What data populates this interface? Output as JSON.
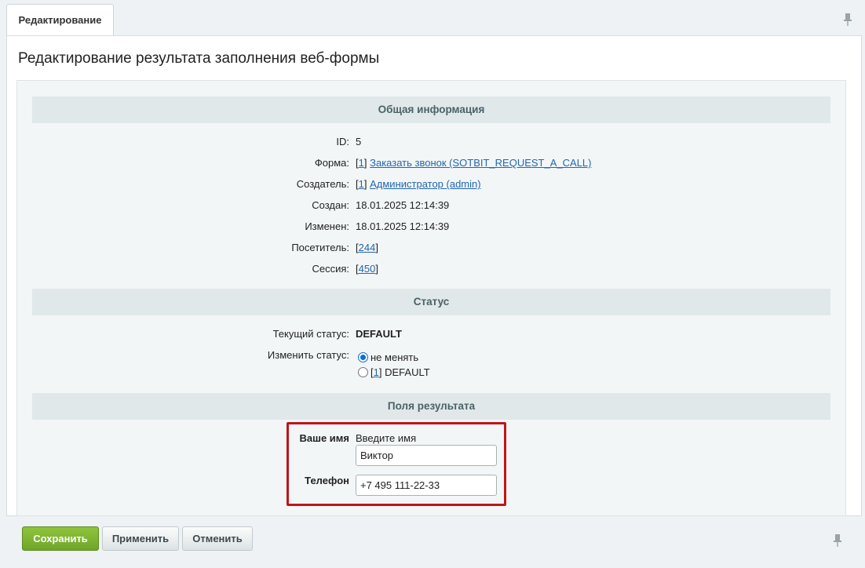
{
  "tab": {
    "label": "Редактирование"
  },
  "page": {
    "title": "Редактирование результата заполнения веб-формы"
  },
  "sections": {
    "general": "Общая информация",
    "status": "Статус",
    "fields": "Поля результата"
  },
  "general": {
    "id_label": "ID:",
    "id_value": "5",
    "form_label": "Форма:",
    "form_bracket_open": "[",
    "form_id": "1",
    "form_bracket_close": "]",
    "form_name": "Заказать звонок (SOTBIT_REQUEST_A_CALL)",
    "creator_label": "Создатель:",
    "creator_bracket_open": "[",
    "creator_id": "1",
    "creator_bracket_close": "]",
    "creator_name": "Администратор (admin)",
    "created_label": "Создан:",
    "created_value": "18.01.2025 12:14:39",
    "modified_label": "Изменен:",
    "modified_value": "18.01.2025 12:14:39",
    "visitor_label": "Посетитель:",
    "visitor_open": "[",
    "visitor_id": "244",
    "visitor_close": "]",
    "session_label": "Сессия:",
    "session_open": "[",
    "session_id": "450",
    "session_close": "]"
  },
  "status": {
    "current_label": "Текущий статус:",
    "current_value": "DEFAULT",
    "change_label": "Изменить статус:",
    "option_keep": "не менять",
    "option_default_open": "[",
    "option_default_id": "1",
    "option_default_close": "]",
    "option_default_name": "DEFAULT"
  },
  "fields": {
    "name_label": "Ваше имя",
    "name_hint": "Введите имя",
    "name_value": "Виктор",
    "phone_label": "Телефон",
    "phone_value": "+7 495 111-22-33"
  },
  "buttons": {
    "save": "Сохранить",
    "apply": "Применить",
    "cancel": "Отменить"
  },
  "colors": {
    "save_button": "#7ab52f",
    "link": "#2067b0",
    "highlight_frame": "#c0141a",
    "section_header": "#e0e8ea"
  },
  "icons": {
    "pin": "pin-icon"
  }
}
